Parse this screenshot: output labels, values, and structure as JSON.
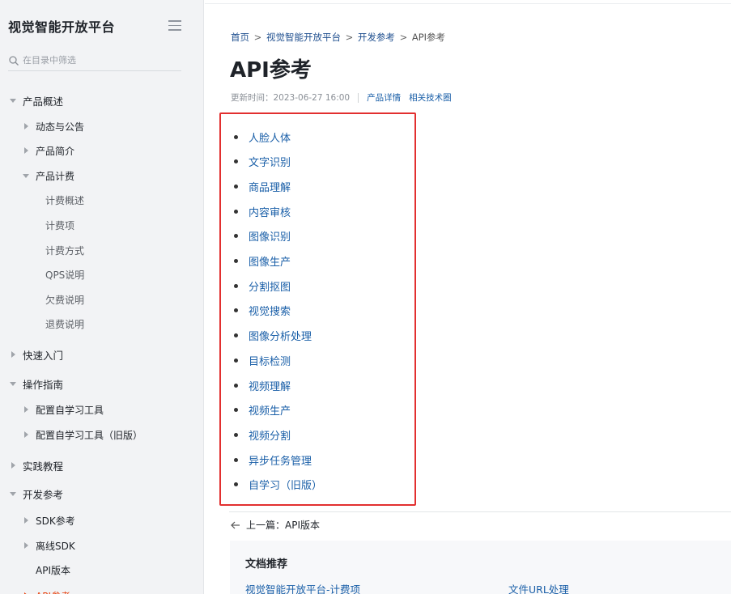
{
  "sidebar": {
    "brand": "视觉智能开放平台",
    "filter_placeholder": "在目录中筛选",
    "items": [
      {
        "label": "产品概述",
        "level": 0,
        "state": "expanded"
      },
      {
        "label": "动态与公告",
        "level": 1,
        "state": "collapsed"
      },
      {
        "label": "产品简介",
        "level": 1,
        "state": "collapsed"
      },
      {
        "label": "产品计费",
        "level": 1,
        "state": "expanded"
      },
      {
        "label": "计费概述",
        "level": 2,
        "state": "leaf"
      },
      {
        "label": "计费项",
        "level": 2,
        "state": "leaf"
      },
      {
        "label": "计费方式",
        "level": 2,
        "state": "leaf"
      },
      {
        "label": "QPS说明",
        "level": 2,
        "state": "leaf"
      },
      {
        "label": "欠费说明",
        "level": 2,
        "state": "leaf"
      },
      {
        "label": "退费说明",
        "level": 2,
        "state": "leaf"
      },
      {
        "label": "快速入门",
        "level": 0,
        "state": "collapsed"
      },
      {
        "label": "操作指南",
        "level": 0,
        "state": "expanded"
      },
      {
        "label": "配置自学习工具",
        "level": 1,
        "state": "collapsed"
      },
      {
        "label": "配置自学习工具（旧版）",
        "level": 1,
        "state": "collapsed"
      },
      {
        "label": "实践教程",
        "level": 0,
        "state": "collapsed"
      },
      {
        "label": "开发参考",
        "level": 0,
        "state": "expanded"
      },
      {
        "label": "SDK参考",
        "level": 1,
        "state": "collapsed"
      },
      {
        "label": "离线SDK",
        "level": 1,
        "state": "collapsed"
      },
      {
        "label": "API版本",
        "level": 1,
        "state": "leaf"
      },
      {
        "label": "API参考",
        "level": 1,
        "state": "active"
      }
    ]
  },
  "breadcrumb": {
    "items": [
      "首页",
      "视觉智能开放平台",
      "开发参考"
    ],
    "current": "API参考",
    "separator": ">"
  },
  "page": {
    "title": "API参考",
    "updated": "更新时间：2023-06-27 16:00",
    "links": [
      "产品详情",
      "相关技术圈"
    ]
  },
  "api_list": [
    "人脸人体",
    "文字识别",
    "商品理解",
    "内容审核",
    "图像识别",
    "图像生产",
    "分割抠图",
    "视觉搜索",
    "图像分析处理",
    "目标检测",
    "视频理解",
    "视频生产",
    "视频分割",
    "异步任务管理",
    "自学习（旧版）"
  ],
  "footer": {
    "prev_label": "上一篇：API版本",
    "recommend_title": "文档推荐",
    "recommend_links": [
      "视觉智能开放平台-计费项",
      "文件URL处理"
    ]
  },
  "colors": {
    "link": "#1a5fa8",
    "highlight_box": "#e22f2f",
    "active_nav": "#e8420f",
    "sidebar_bg": "#f2f3f5"
  }
}
